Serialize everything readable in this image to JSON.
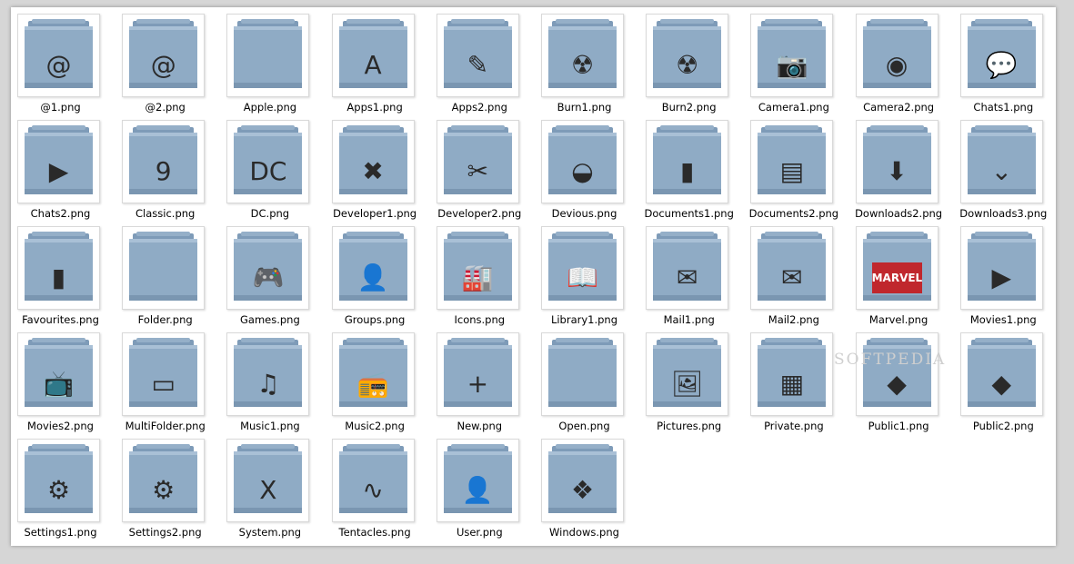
{
  "window": {
    "title": ""
  },
  "watermark": "SOFTPEDIA",
  "colors": {
    "folder_body": "#8aa7c2",
    "folder_tab": "#6f8fae",
    "background": "#ffffff"
  },
  "files": [
    {
      "name": "@1.png",
      "icon": "at-sign-icon",
      "glyph": "@"
    },
    {
      "name": "@2.png",
      "icon": "address-book-icon",
      "glyph": "@"
    },
    {
      "name": "Apple.png",
      "icon": "apple-logo-icon",
      "glyph": ""
    },
    {
      "name": "Apps1.png",
      "icon": "app-store-icon",
      "glyph": "A"
    },
    {
      "name": "Apps2.png",
      "icon": "ruler-pencil-icon",
      "glyph": "✎"
    },
    {
      "name": "Burn1.png",
      "icon": "radiation-icon",
      "glyph": "☢"
    },
    {
      "name": "Burn2.png",
      "icon": "radiation-disc-icon",
      "glyph": "☢"
    },
    {
      "name": "Camera1.png",
      "icon": "camera-icon",
      "glyph": "📷"
    },
    {
      "name": "Camera2.png",
      "icon": "webcam-icon",
      "glyph": "◉"
    },
    {
      "name": "Chats1.png",
      "icon": "chat-bubbles-icon",
      "glyph": "💬"
    },
    {
      "name": "Chats2.png",
      "icon": "video-chat-icon",
      "glyph": "▶"
    },
    {
      "name": "Classic.png",
      "icon": "classic-nine-icon",
      "glyph": "9"
    },
    {
      "name": "DC.png",
      "icon": "dc-logo-icon",
      "glyph": "DC"
    },
    {
      "name": "Developer1.png",
      "icon": "developer-x-icon",
      "glyph": "✖"
    },
    {
      "name": "Developer2.png",
      "icon": "developer-tools-icon",
      "glyph": "✂"
    },
    {
      "name": "Devious.png",
      "icon": "deviantart-icon",
      "glyph": "◒"
    },
    {
      "name": "Documents1.png",
      "icon": "document-icon",
      "glyph": "▮"
    },
    {
      "name": "Documents2.png",
      "icon": "papers-icon",
      "glyph": "▤"
    },
    {
      "name": "Downloads2.png",
      "icon": "green-download-arrow-icon",
      "glyph": "⬇"
    },
    {
      "name": "Downloads3.png",
      "icon": "chevrons-down-icon",
      "glyph": "⌄"
    },
    {
      "name": "Favourites.png",
      "icon": "bookmark-icon",
      "glyph": "▮"
    },
    {
      "name": "Folder.png",
      "icon": "plain-folder-icon",
      "glyph": ""
    },
    {
      "name": "Games.png",
      "icon": "gamepad-icon",
      "glyph": "🎮"
    },
    {
      "name": "Groups.png",
      "icon": "person-silhouette-icon",
      "glyph": "👤"
    },
    {
      "name": "Icons.png",
      "icon": "factory-icon",
      "glyph": "🏭"
    },
    {
      "name": "Library1.png",
      "icon": "open-book-icon",
      "glyph": "📖"
    },
    {
      "name": "Mail1.png",
      "icon": "envelope-icon",
      "glyph": "✉"
    },
    {
      "name": "Mail2.png",
      "icon": "envelope-stamp-icon",
      "glyph": "✉"
    },
    {
      "name": "Marvel.png",
      "icon": "marvel-logo-icon",
      "glyph": "MARVEL"
    },
    {
      "name": "Movies1.png",
      "icon": "video-camera-icon",
      "glyph": "▶"
    },
    {
      "name": "Movies2.png",
      "icon": "tv-set-icon",
      "glyph": "📺"
    },
    {
      "name": "MultiFolder.png",
      "icon": "multi-folder-icon",
      "glyph": "▭"
    },
    {
      "name": "Music1.png",
      "icon": "music-note-icon",
      "glyph": "♫"
    },
    {
      "name": "Music2.png",
      "icon": "boombox-icon",
      "glyph": "📻"
    },
    {
      "name": "New.png",
      "icon": "new-plus-icon",
      "glyph": "+"
    },
    {
      "name": "Open.png",
      "icon": "open-folder-icon",
      "glyph": ""
    },
    {
      "name": "Pictures.png",
      "icon": "picture-icon",
      "glyph": "🖼"
    },
    {
      "name": "Private.png",
      "icon": "warning-stripes-icon",
      "glyph": "▦"
    },
    {
      "name": "Public1.png",
      "icon": "pedestrian-sign-icon",
      "glyph": "◆"
    },
    {
      "name": "Public2.png",
      "icon": "yellow-pedestrian-sign-icon",
      "glyph": "◆"
    },
    {
      "name": "Settings1.png",
      "icon": "gear-icon",
      "glyph": "⚙"
    },
    {
      "name": "Settings2.png",
      "icon": "metal-gear-icon",
      "glyph": "⚙"
    },
    {
      "name": "System.png",
      "icon": "system-x-icon",
      "glyph": "X"
    },
    {
      "name": "Tentacles.png",
      "icon": "tentacles-icon",
      "glyph": "∿"
    },
    {
      "name": "User.png",
      "icon": "user-icon",
      "glyph": "👤"
    },
    {
      "name": "Windows.png",
      "icon": "windows-logo-icon",
      "glyph": "❖"
    }
  ]
}
